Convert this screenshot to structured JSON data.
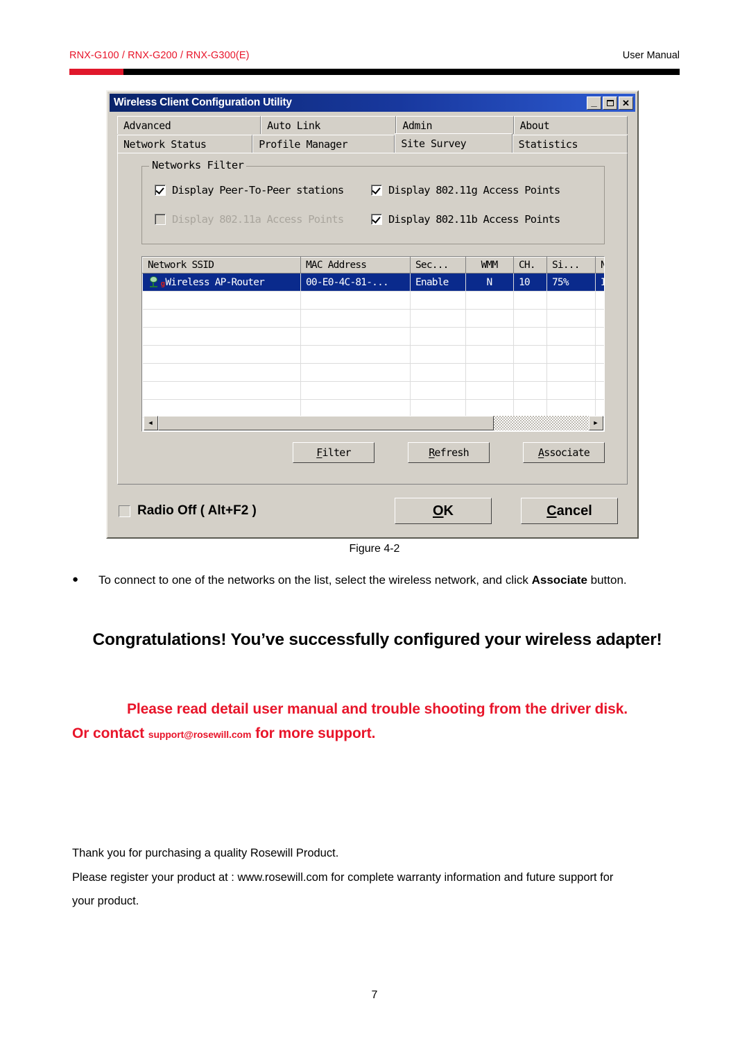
{
  "header": {
    "models": "RNX-G100 / RNX-G200 / RNX-G300(E)",
    "doc_type": "User  Manual",
    "accent_red": "#e0172b",
    "rule_black": "#000000"
  },
  "dialog": {
    "title": "Wireless Client Configuration Utility",
    "titlebar_color": "#0a246a",
    "window_buttons": [
      {
        "name": "minimize",
        "glyph": "_"
      },
      {
        "name": "maximize",
        "glyph": "□"
      },
      {
        "name": "close",
        "glyph": "✕"
      }
    ],
    "tabs_row1": [
      {
        "label": "Advanced",
        "selected": false
      },
      {
        "label": "Auto Link",
        "selected": false
      },
      {
        "label": "Admin",
        "selected": false
      },
      {
        "label": "About",
        "selected": false
      }
    ],
    "tabs_row2": [
      {
        "label": "Network Status",
        "selected": false
      },
      {
        "label": "Profile Manager",
        "selected": false
      },
      {
        "label": "Site Survey",
        "selected": true
      },
      {
        "label": "Statistics",
        "selected": false
      }
    ],
    "networks_filter": {
      "group_title": "Networks Filter",
      "options": [
        {
          "label": "Display Peer-To-Peer stations",
          "checked": true,
          "disabled": false
        },
        {
          "label": "Display 802.11g Access Points",
          "checked": true,
          "disabled": false
        },
        {
          "label": "Display 802.11a Access Points",
          "checked": false,
          "disabled": true
        },
        {
          "label": "Display 802.11b Access Points",
          "checked": true,
          "disabled": false
        }
      ]
    },
    "network_table": {
      "columns": [
        "Network SSID",
        "MAC Address",
        "Sec...",
        "WMM",
        "CH.",
        "Si...",
        "Ne"
      ],
      "rows": [
        {
          "selected": true,
          "icon": "access-point-icon",
          "icon_badge": "g",
          "ssid": "Wireless AP-Router",
          "mac": "00-E0-4C-81-...",
          "security": "Enable",
          "wmm": "N",
          "channel": "10",
          "signal": "75%",
          "network_type": "In"
        }
      ],
      "empty_row_count": 7,
      "selected_row_color": "#0a2a8c"
    },
    "scrollbar": {
      "left_arrow": "◄",
      "right_arrow": "►"
    },
    "action_buttons": [
      {
        "label": "Filter",
        "accel": "F"
      },
      {
        "label": "Refresh",
        "accel": "R"
      },
      {
        "label": "Associate",
        "accel": "A"
      }
    ],
    "radio_off": {
      "label": "Radio Off  ( Alt+F2 )",
      "checked": false
    },
    "dialog_buttons": [
      {
        "label": "OK",
        "accel": "O"
      },
      {
        "label": "Cancel",
        "accel": "C"
      }
    ]
  },
  "figure": {
    "caption": "Figure 4-2"
  },
  "body": {
    "bullet_marker": "●",
    "bullet_text_pre": "To connect to one of the networks on the list, select the wireless network, and click ",
    "bullet_text_bold": "Associate",
    "bullet_text_post": " button.",
    "congratulations": "Congratulations! You’ve successfully configured your wireless adapter!",
    "red_line_1": "Please read detail user manual and trouble shooting from the driver disk.",
    "red_line_2_pre": "Or contact ",
    "red_line_2_email": "support@rosewill.com",
    "red_line_2_post": " for more support.",
    "red_color": "#e8152a",
    "thanks_line_1": "Thank you for purchasing a quality Rosewill Product.",
    "thanks_line_2": "Please register your product at : www.rosewill.com for complete warranty information and future support for",
    "thanks_line_3": "your product."
  },
  "footer": {
    "page_number": "7"
  }
}
